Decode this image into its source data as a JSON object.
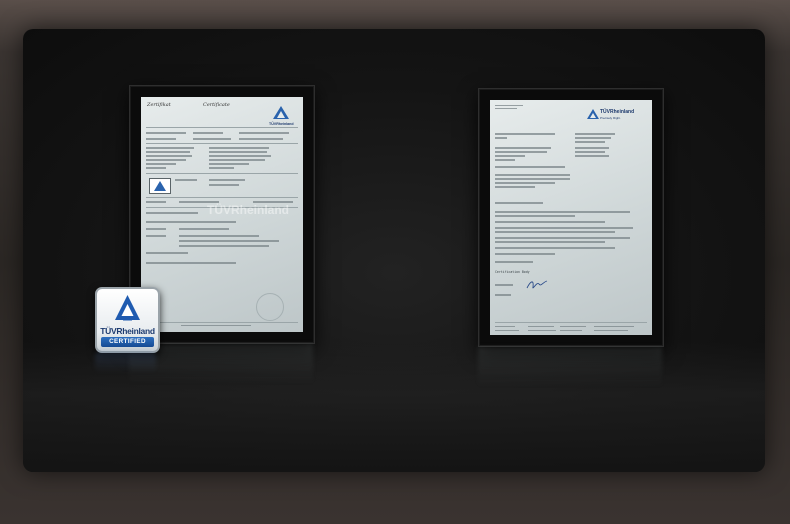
{
  "left_certificate": {
    "title_de": "Zertifikat",
    "title_en": "Certificate",
    "watermark": "TÜVRheinland",
    "brand": "TÜVRheinland"
  },
  "right_certificate": {
    "brand": "TÜVRheinland",
    "brand_tagline": "Precisely Right.",
    "closing": "Certification Body"
  },
  "badge": {
    "brand": "TÜVRheinland",
    "label": "CERTIFIED",
    "colors": {
      "navy": "#1d3b70",
      "blue": "#2d6fc0"
    }
  }
}
